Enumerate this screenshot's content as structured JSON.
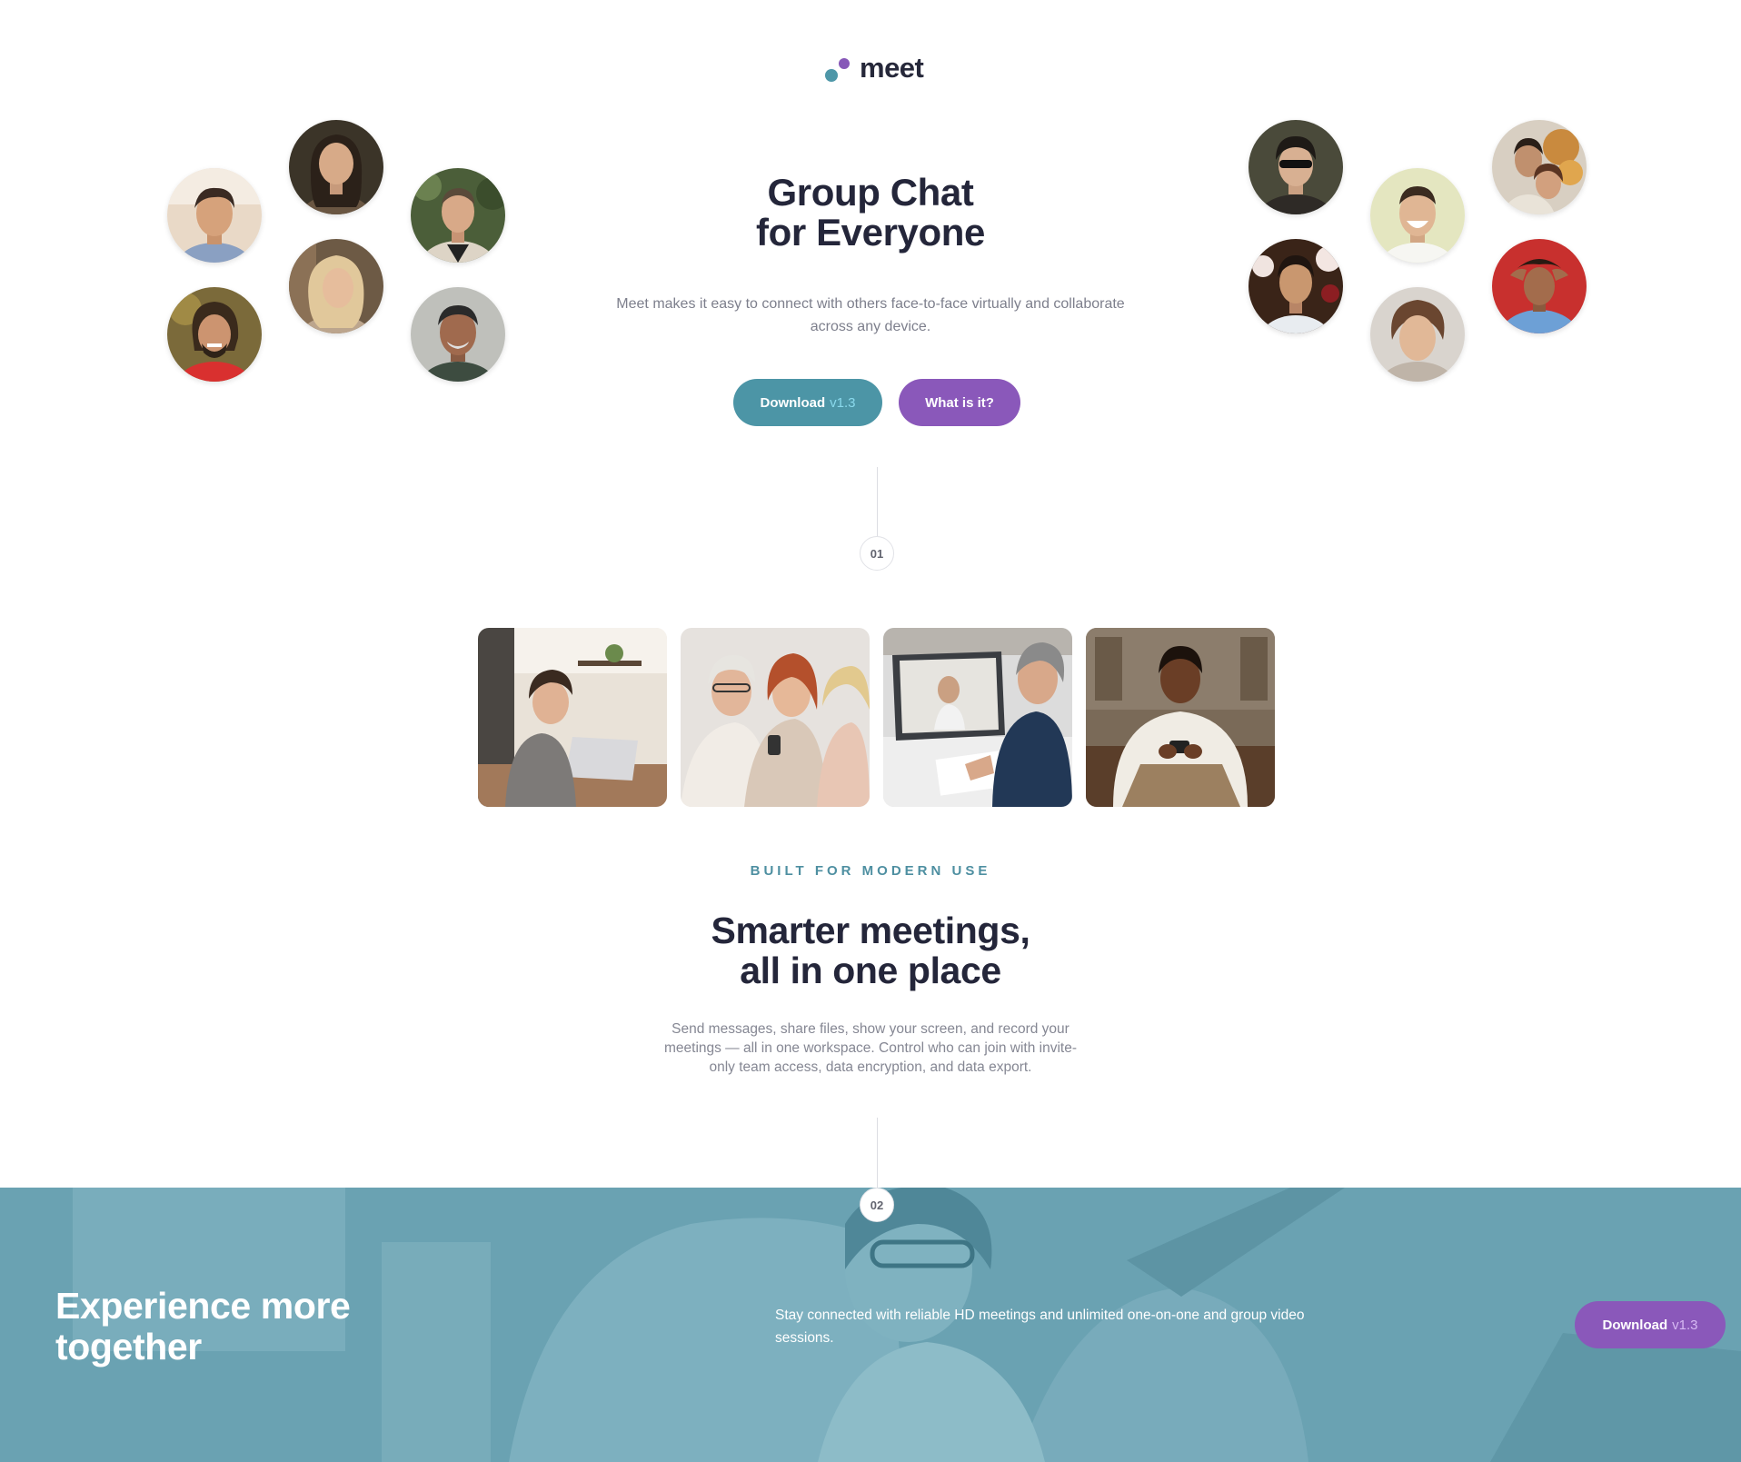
{
  "brand": {
    "name": "meet",
    "colors": {
      "teal": "#4c95a6",
      "purple": "#8a58ba",
      "dark": "#24263a",
      "banner": "#6aa2b2"
    }
  },
  "hero": {
    "title_line1": "Group Chat",
    "title_line2": "for Everyone",
    "subtitle": "Meet makes it easy to connect with others face-to-face virtually and collaborate across any device.",
    "download_button": {
      "label": "Download",
      "version": "v1.3"
    },
    "info_button": {
      "label": "What is it?"
    }
  },
  "avatars": {
    "left": [
      "avatar-user-1",
      "avatar-user-2",
      "avatar-user-3",
      "avatar-user-4",
      "avatar-user-5",
      "avatar-user-6"
    ],
    "right": [
      "avatar-user-7",
      "avatar-user-8",
      "avatar-user-9",
      "avatar-user-10",
      "avatar-user-11",
      "avatar-user-12"
    ]
  },
  "steps": {
    "first": "01",
    "second": "02"
  },
  "photos": [
    "photo-woman-laptop",
    "photo-friends-phone",
    "photo-video-call",
    "photo-man-phone"
  ],
  "section_modern": {
    "eyebrow": "BUILT FOR MODERN USE",
    "title_line1": "Smarter meetings,",
    "title_line2": "all in one place",
    "body": "Send messages, share files, show your screen, and record your meetings — all in one workspace. Control who can join with invite-only team access, data encryption, and data export."
  },
  "banner": {
    "title_line1": "Experience more",
    "title_line2": "together",
    "text": "Stay connected with reliable HD meetings and unlimited one-on-one and group video sessions.",
    "download_button": {
      "label": "Download",
      "version": "v1.3"
    }
  }
}
